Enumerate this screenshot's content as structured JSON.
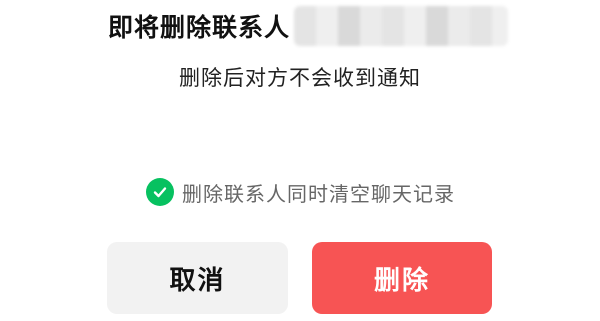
{
  "dialog": {
    "title": "即将删除联系人",
    "subtitle": "删除后对方不会收到通知",
    "clear_history": {
      "label": "删除联系人同时清空聊天记录",
      "checked": true,
      "check_color": "#07c160"
    },
    "cancel_label": "取消",
    "delete_label": "删除",
    "delete_color": "#f75454"
  },
  "icons": {
    "checkbox": "check-circle-icon"
  }
}
